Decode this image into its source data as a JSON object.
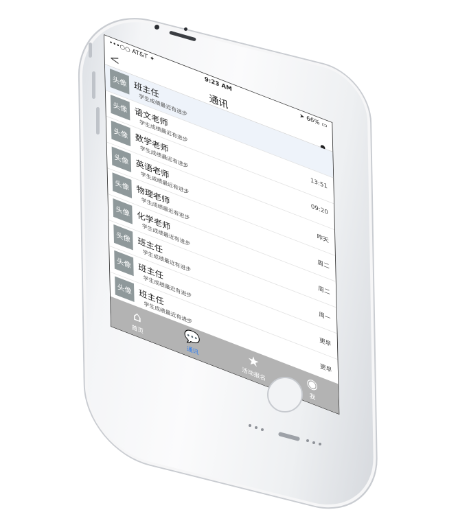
{
  "status_bar": {
    "carrier": "•••○○ AT&T ✦",
    "time": "9:23 AM",
    "battery": "➤ 66% ▭"
  },
  "nav": {
    "back": "<",
    "title": "通讯",
    "user_icon": "person-icon"
  },
  "rows": [
    {
      "avatar": "头像",
      "name": "班主任",
      "message": "学生成绩最近有进步",
      "stamp": ""
    },
    {
      "avatar": "头像",
      "name": "语文老师",
      "message": "学生成绩最近有进步",
      "stamp": "13:51"
    },
    {
      "avatar": "头像",
      "name": "数学老师",
      "message": "学生成绩最近有进步",
      "stamp": "09:20"
    },
    {
      "avatar": "头像",
      "name": "英语老师",
      "message": "学生成绩最近有进步",
      "stamp": "昨天"
    },
    {
      "avatar": "头像",
      "name": "物理老师",
      "message": "学生成绩最近有进步",
      "stamp": "周二"
    },
    {
      "avatar": "头像",
      "name": "化学老师",
      "message": "学生成绩最近有进步",
      "stamp": "周二"
    },
    {
      "avatar": "头像",
      "name": "班主任",
      "message": "学生成绩最近有进步",
      "stamp": "周一"
    },
    {
      "avatar": "头像",
      "name": "班主任",
      "message": "学生成绩最近有进步",
      "stamp": "更早"
    },
    {
      "avatar": "头像",
      "name": "班主任",
      "message": "学生成绩最近有进步",
      "stamp": "更早"
    },
    {
      "avatar": "头像",
      "name": "班主任",
      "message": "",
      "stamp": "更早"
    }
  ],
  "tabs": [
    {
      "label": "首页",
      "icon": "home-icon",
      "glyph": "⌂"
    },
    {
      "label": "通讯",
      "icon": "chat-bubbles-icon",
      "glyph": "💬"
    },
    {
      "label": "活动报名",
      "icon": "stars-icon",
      "glyph": "★"
    },
    {
      "label": "我",
      "icon": "profile-icon",
      "glyph": "◉"
    }
  ],
  "colors": {
    "active_tab": "#2f7ef2",
    "tabbar_bg": "#b3b3b3",
    "avatar_bg": "#8f999b"
  }
}
